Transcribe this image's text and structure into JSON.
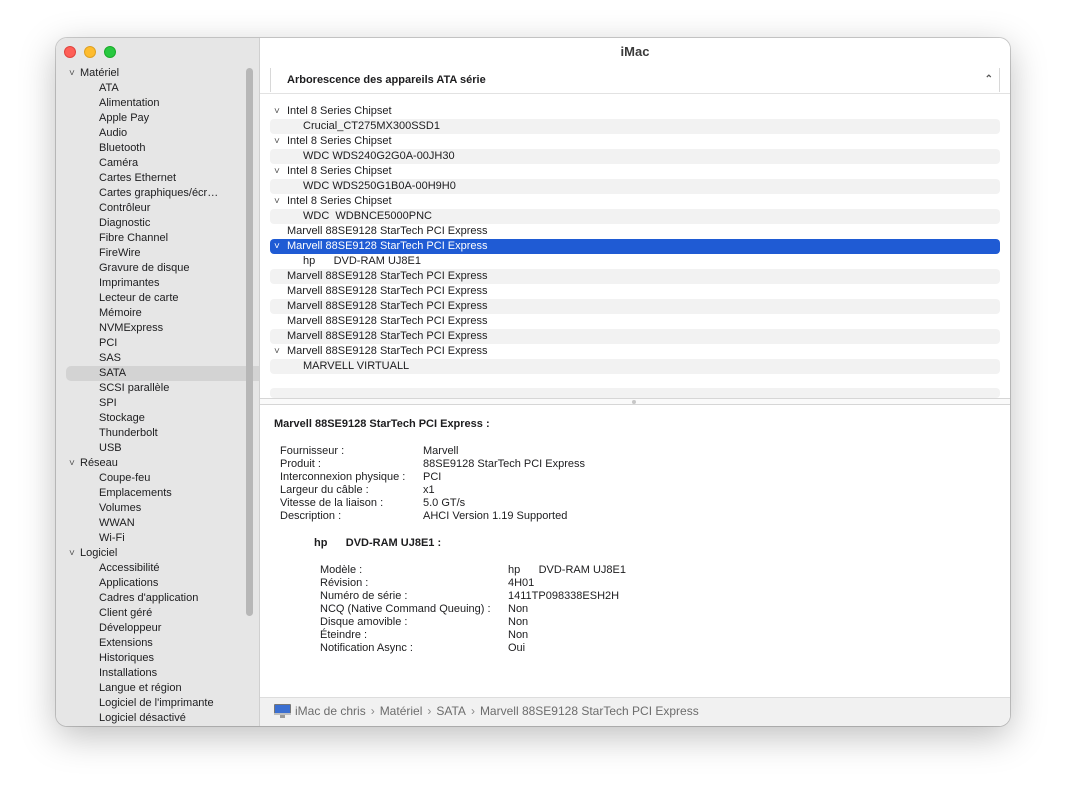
{
  "window": {
    "title": "iMac"
  },
  "sidebar": {
    "sections": [
      {
        "label": "Matériel",
        "items": [
          "ATA",
          "Alimentation",
          "Apple Pay",
          "Audio",
          "Bluetooth",
          "Caméra",
          "Cartes Ethernet",
          "Cartes graphiques/écr…",
          "Contrôleur",
          "Diagnostic",
          "Fibre Channel",
          "FireWire",
          "Gravure de disque",
          "Imprimantes",
          "Lecteur de carte",
          "Mémoire",
          "NVMExpress",
          "PCI",
          "SAS",
          "SATA",
          "SCSI parallèle",
          "SPI",
          "Stockage",
          "Thunderbolt",
          "USB"
        ]
      },
      {
        "label": "Réseau",
        "items": [
          "Coupe-feu",
          "Emplacements",
          "Volumes",
          "WWAN",
          "Wi-Fi"
        ]
      },
      {
        "label": "Logiciel",
        "items": [
          "Accessibilité",
          "Applications",
          "Cadres d'application",
          "Client géré",
          "Développeur",
          "Extensions",
          "Historiques",
          "Installations",
          "Langue et région",
          "Logiciel de l'imprimante",
          "Logiciel désactivé"
        ]
      }
    ],
    "selected": "SATA"
  },
  "list": {
    "header": "Arborescence des appareils ATA série",
    "rows": [
      {
        "text": "Intel 8 Series Chipset",
        "level": 0,
        "expanded": true
      },
      {
        "text": "Crucial_CT275MX300SSD1",
        "level": 1
      },
      {
        "text": "Intel 8 Series Chipset",
        "level": 0,
        "expanded": true
      },
      {
        "text": "WDC WDS240G2G0A-00JH30",
        "level": 1
      },
      {
        "text": "Intel 8 Series Chipset",
        "level": 0,
        "expanded": true
      },
      {
        "text": "WDC WDS250G1B0A-00H9H0",
        "level": 1
      },
      {
        "text": "Intel 8 Series Chipset",
        "level": 0,
        "expanded": true
      },
      {
        "text": "WDC  WDBNCE5000PNC",
        "level": 1
      },
      {
        "text": "Marvell 88SE9128 StarTech PCI Express",
        "level": 0
      },
      {
        "text": "Marvell 88SE9128 StarTech PCI Express",
        "level": 0,
        "expanded": true,
        "selected": true
      },
      {
        "text": "hp      DVD-RAM UJ8E1",
        "level": 1
      },
      {
        "text": "Marvell 88SE9128 StarTech PCI Express",
        "level": 0
      },
      {
        "text": "Marvell 88SE9128 StarTech PCI Express",
        "level": 0
      },
      {
        "text": "Marvell 88SE9128 StarTech PCI Express",
        "level": 0
      },
      {
        "text": "Marvell 88SE9128 StarTech PCI Express",
        "level": 0
      },
      {
        "text": "Marvell 88SE9128 StarTech PCI Express",
        "level": 0
      },
      {
        "text": "Marvell 88SE9128 StarTech PCI Express",
        "level": 0,
        "expanded": true
      },
      {
        "text": "MARVELL VIRTUALL",
        "level": 1
      }
    ]
  },
  "detail": {
    "title": "Marvell 88SE9128 StarTech PCI Express :",
    "fields": [
      {
        "label": "Fournisseur :",
        "value": "Marvell"
      },
      {
        "label": "Produit :",
        "value": "88SE9128 StarTech PCI Express"
      },
      {
        "label": "Interconnexion physique :",
        "value": "PCI"
      },
      {
        "label": "Largeur du câble :",
        "value": "x1"
      },
      {
        "label": "Vitesse de la liaison :",
        "value": "5.0 GT/s"
      },
      {
        "label": "Description :",
        "value": "AHCI Version 1.19 Supported"
      }
    ],
    "device_title": "hp      DVD-RAM UJ8E1 :",
    "device_fields": [
      {
        "label": "Modèle :",
        "value": "hp      DVD-RAM UJ8E1"
      },
      {
        "label": "Révision :",
        "value": "4H01"
      },
      {
        "label": "Numéro de série :",
        "value": "1411TP098338ESH2H"
      },
      {
        "label": "NCQ (Native Command Queuing) :",
        "value": "Non"
      },
      {
        "label": "Disque amovible :",
        "value": "Non"
      },
      {
        "label": "Éteindre :",
        "value": "Non"
      },
      {
        "label": "Notification Async :",
        "value": "Oui"
      }
    ]
  },
  "statusbar": {
    "breadcrumb": [
      "iMac de chris",
      "Matériel",
      "SATA",
      "Marvell 88SE9128 StarTech PCI Express"
    ],
    "icon": "imac-icon"
  },
  "colors": {
    "selection": "#1f5bd4",
    "sidebar_bg": "#e6e6e6",
    "sidebar_selected": "#d3d3d3"
  }
}
